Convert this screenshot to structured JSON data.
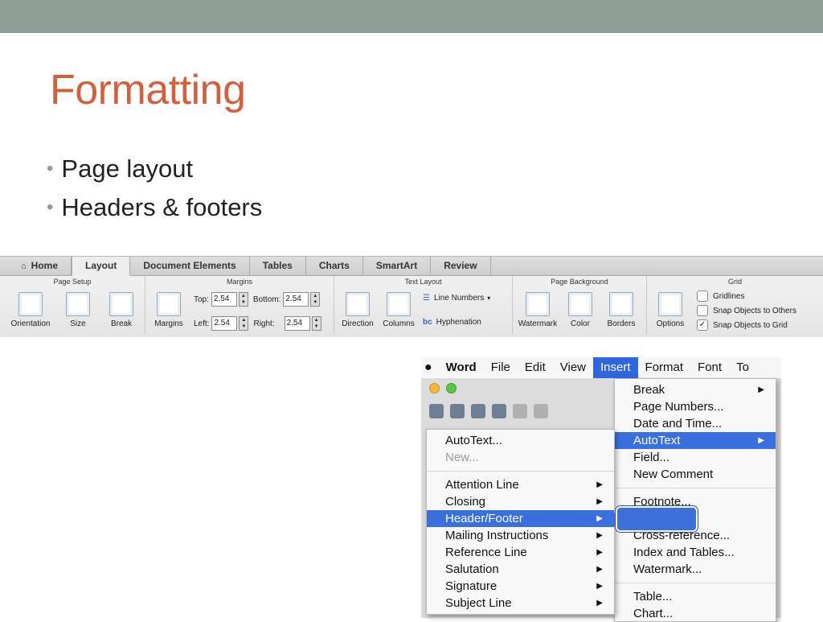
{
  "slide": {
    "title": "Formatting",
    "bullets": [
      "Page layout",
      "Headers & footers"
    ],
    "colors": {
      "topbar": "#8f9e96",
      "title": "#d35f3c"
    }
  },
  "ribbon": {
    "tabs": [
      "Home",
      "Layout",
      "Document Elements",
      "Tables",
      "Charts",
      "SmartArt",
      "Review"
    ],
    "active_tab": "Layout",
    "groups": {
      "page_setup": {
        "title": "Page Setup",
        "buttons": [
          "Orientation",
          "Size",
          "Break"
        ]
      },
      "margins": {
        "title": "Margins",
        "button": "Margins",
        "top_label": "Top:",
        "top_value": "2.54",
        "bottom_label": "Bottom:",
        "bottom_value": "2.54",
        "left_label": "Left:",
        "left_value": "2.54",
        "right_label": "Right:",
        "right_value": "2.54"
      },
      "text_layout": {
        "title": "Text Layout",
        "buttons": [
          "Direction",
          "Columns"
        ],
        "line_numbers": "Line Numbers",
        "hyphenation": "Hyphenation"
      },
      "page_background": {
        "title": "Page Background",
        "buttons": [
          "Watermark",
          "Color",
          "Borders"
        ]
      },
      "grid": {
        "title": "Grid",
        "options": "Options",
        "gridlines": "Gridlines",
        "snap_others": "Snap Objects to Others",
        "snap_grid": "Snap Objects to Grid",
        "snap_grid_checked": true
      }
    }
  },
  "menubar": {
    "apple_icon": "apple-icon",
    "items": [
      "Word",
      "File",
      "Edit",
      "View",
      "Insert",
      "Format",
      "Font",
      "To"
    ],
    "active": "Insert"
  },
  "insert_menu": [
    {
      "label": "Break",
      "submenu": true
    },
    {
      "label": "Page Numbers...",
      "submenu": false
    },
    {
      "label": "Date and Time...",
      "submenu": false
    },
    {
      "label": "AutoText",
      "submenu": true,
      "highlighted": true
    },
    {
      "label": "Field...",
      "submenu": false
    },
    {
      "label": "New Comment",
      "submenu": false
    },
    {
      "separator": true
    },
    {
      "label": "Footnote...",
      "submenu": false
    },
    {
      "label": "",
      "submenu": false
    },
    {
      "label": "Cross-reference...",
      "submenu": false
    },
    {
      "label": "Index and Tables...",
      "submenu": false
    },
    {
      "label": "Watermark...",
      "submenu": false
    },
    {
      "separator": true
    },
    {
      "label": "Table...",
      "submenu": false
    },
    {
      "label": "Chart...",
      "submenu": false
    }
  ],
  "autotext_menu": [
    {
      "label": "AutoText...",
      "submenu": false
    },
    {
      "label": "New...",
      "submenu": false,
      "disabled": true
    },
    {
      "separator": true
    },
    {
      "label": "Attention Line",
      "submenu": true
    },
    {
      "label": "Closing",
      "submenu": true
    },
    {
      "label": "Header/Footer",
      "submenu": true,
      "highlighted": true
    },
    {
      "label": "Mailing Instructions",
      "submenu": true
    },
    {
      "label": "Reference Line",
      "submenu": true
    },
    {
      "label": "Salutation",
      "submenu": true
    },
    {
      "label": "Signature",
      "submenu": true
    },
    {
      "label": "Subject Line",
      "submenu": true
    }
  ],
  "callout_color": "#3f6fd8"
}
